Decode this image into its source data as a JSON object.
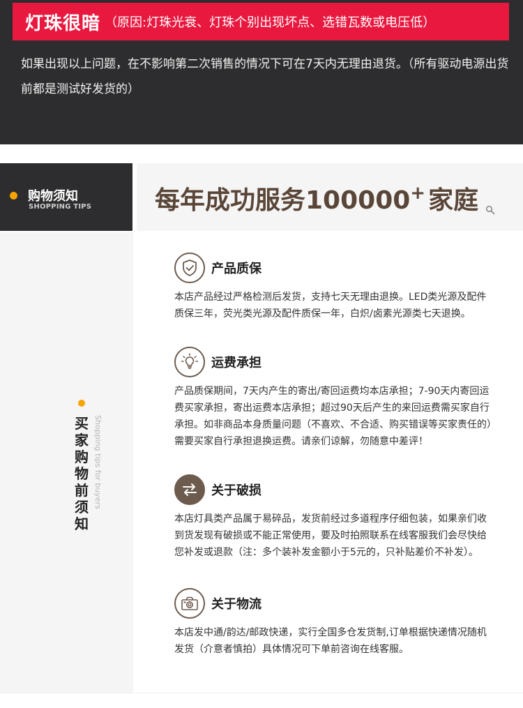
{
  "notice": {
    "banner_title": "灯珠很暗",
    "banner_reason": "（原因:灯珠光衰、灯珠个别出现坏点、选错瓦数或电压低）",
    "text": "如果出现以上问题，在不影响第二次销售的情况下可在7天内无理由退货。（所有驱动电源出货前都是测试好发货的）"
  },
  "tips_badge": {
    "title": "购物须知",
    "subtitle": "SHOPPING TIPS"
  },
  "slogan": {
    "text": "每年成功服务100000",
    "plus": "+",
    "suffix": "家庭"
  },
  "sidebar": {
    "title": "买家购物前须知",
    "subtitle": "Shopping tips for buyers"
  },
  "sections": [
    {
      "icon": "shield-check-icon",
      "title": "产品质保",
      "body": "本店产品经过严格检测后发货，支持七天无理由退换。LED类光源及配件质保三年，荧光类光源及配件质保一年，白炽/卤素光源类七天退换。"
    },
    {
      "icon": "lightbulb-icon",
      "title": "运费承担",
      "body": "产品质保期间，7天内产生的寄出/寄回运费均本店承担；7-90天内寄回运费买家承担，寄出运费本店承担；超过90天后产生的来回运费需买家自行承担。如非商品本身质量问题（不喜欢、不合适、购买错误等买家责任的）需要买家自行承担退换运费。请亲们谅解，勿随意中差评！"
    },
    {
      "icon": "exchange-arrows-icon",
      "title": "关于破损",
      "body": "本店灯具类产品属于易碎品，发货前经过多道程序仔细包装，如果亲们收到货发现有破损或不能正常使用，要及时拍照联系在线客服我们会尽快给您补发或退款（注：多个装补发金额小于5元的，只补贴差价不补发）。"
    },
    {
      "icon": "camera-icon",
      "title": "关于物流",
      "body": "本店发中通/韵达/邮政快递，实行全国多仓发货制,订单根据快递情况随机发货（介意者慎拍）具体情况可下单前咨询在线客服。"
    }
  ],
  "colors": {
    "dark": "#2d2d2f",
    "red": "#e8183f",
    "accent": "#f5a400",
    "brown": "#5a4638"
  }
}
